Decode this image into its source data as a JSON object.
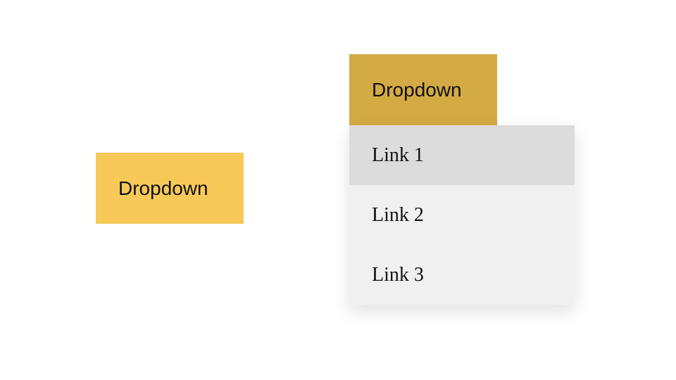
{
  "dropdown_closed": {
    "label": "Dropdown",
    "color": "#f7c958"
  },
  "dropdown_open": {
    "label": "Dropdown",
    "color": "#d4aa44",
    "expanded": true,
    "items": [
      {
        "label": "Link 1",
        "hovered": true
      },
      {
        "label": "Link 2",
        "hovered": false
      },
      {
        "label": "Link 3",
        "hovered": false
      }
    ]
  }
}
